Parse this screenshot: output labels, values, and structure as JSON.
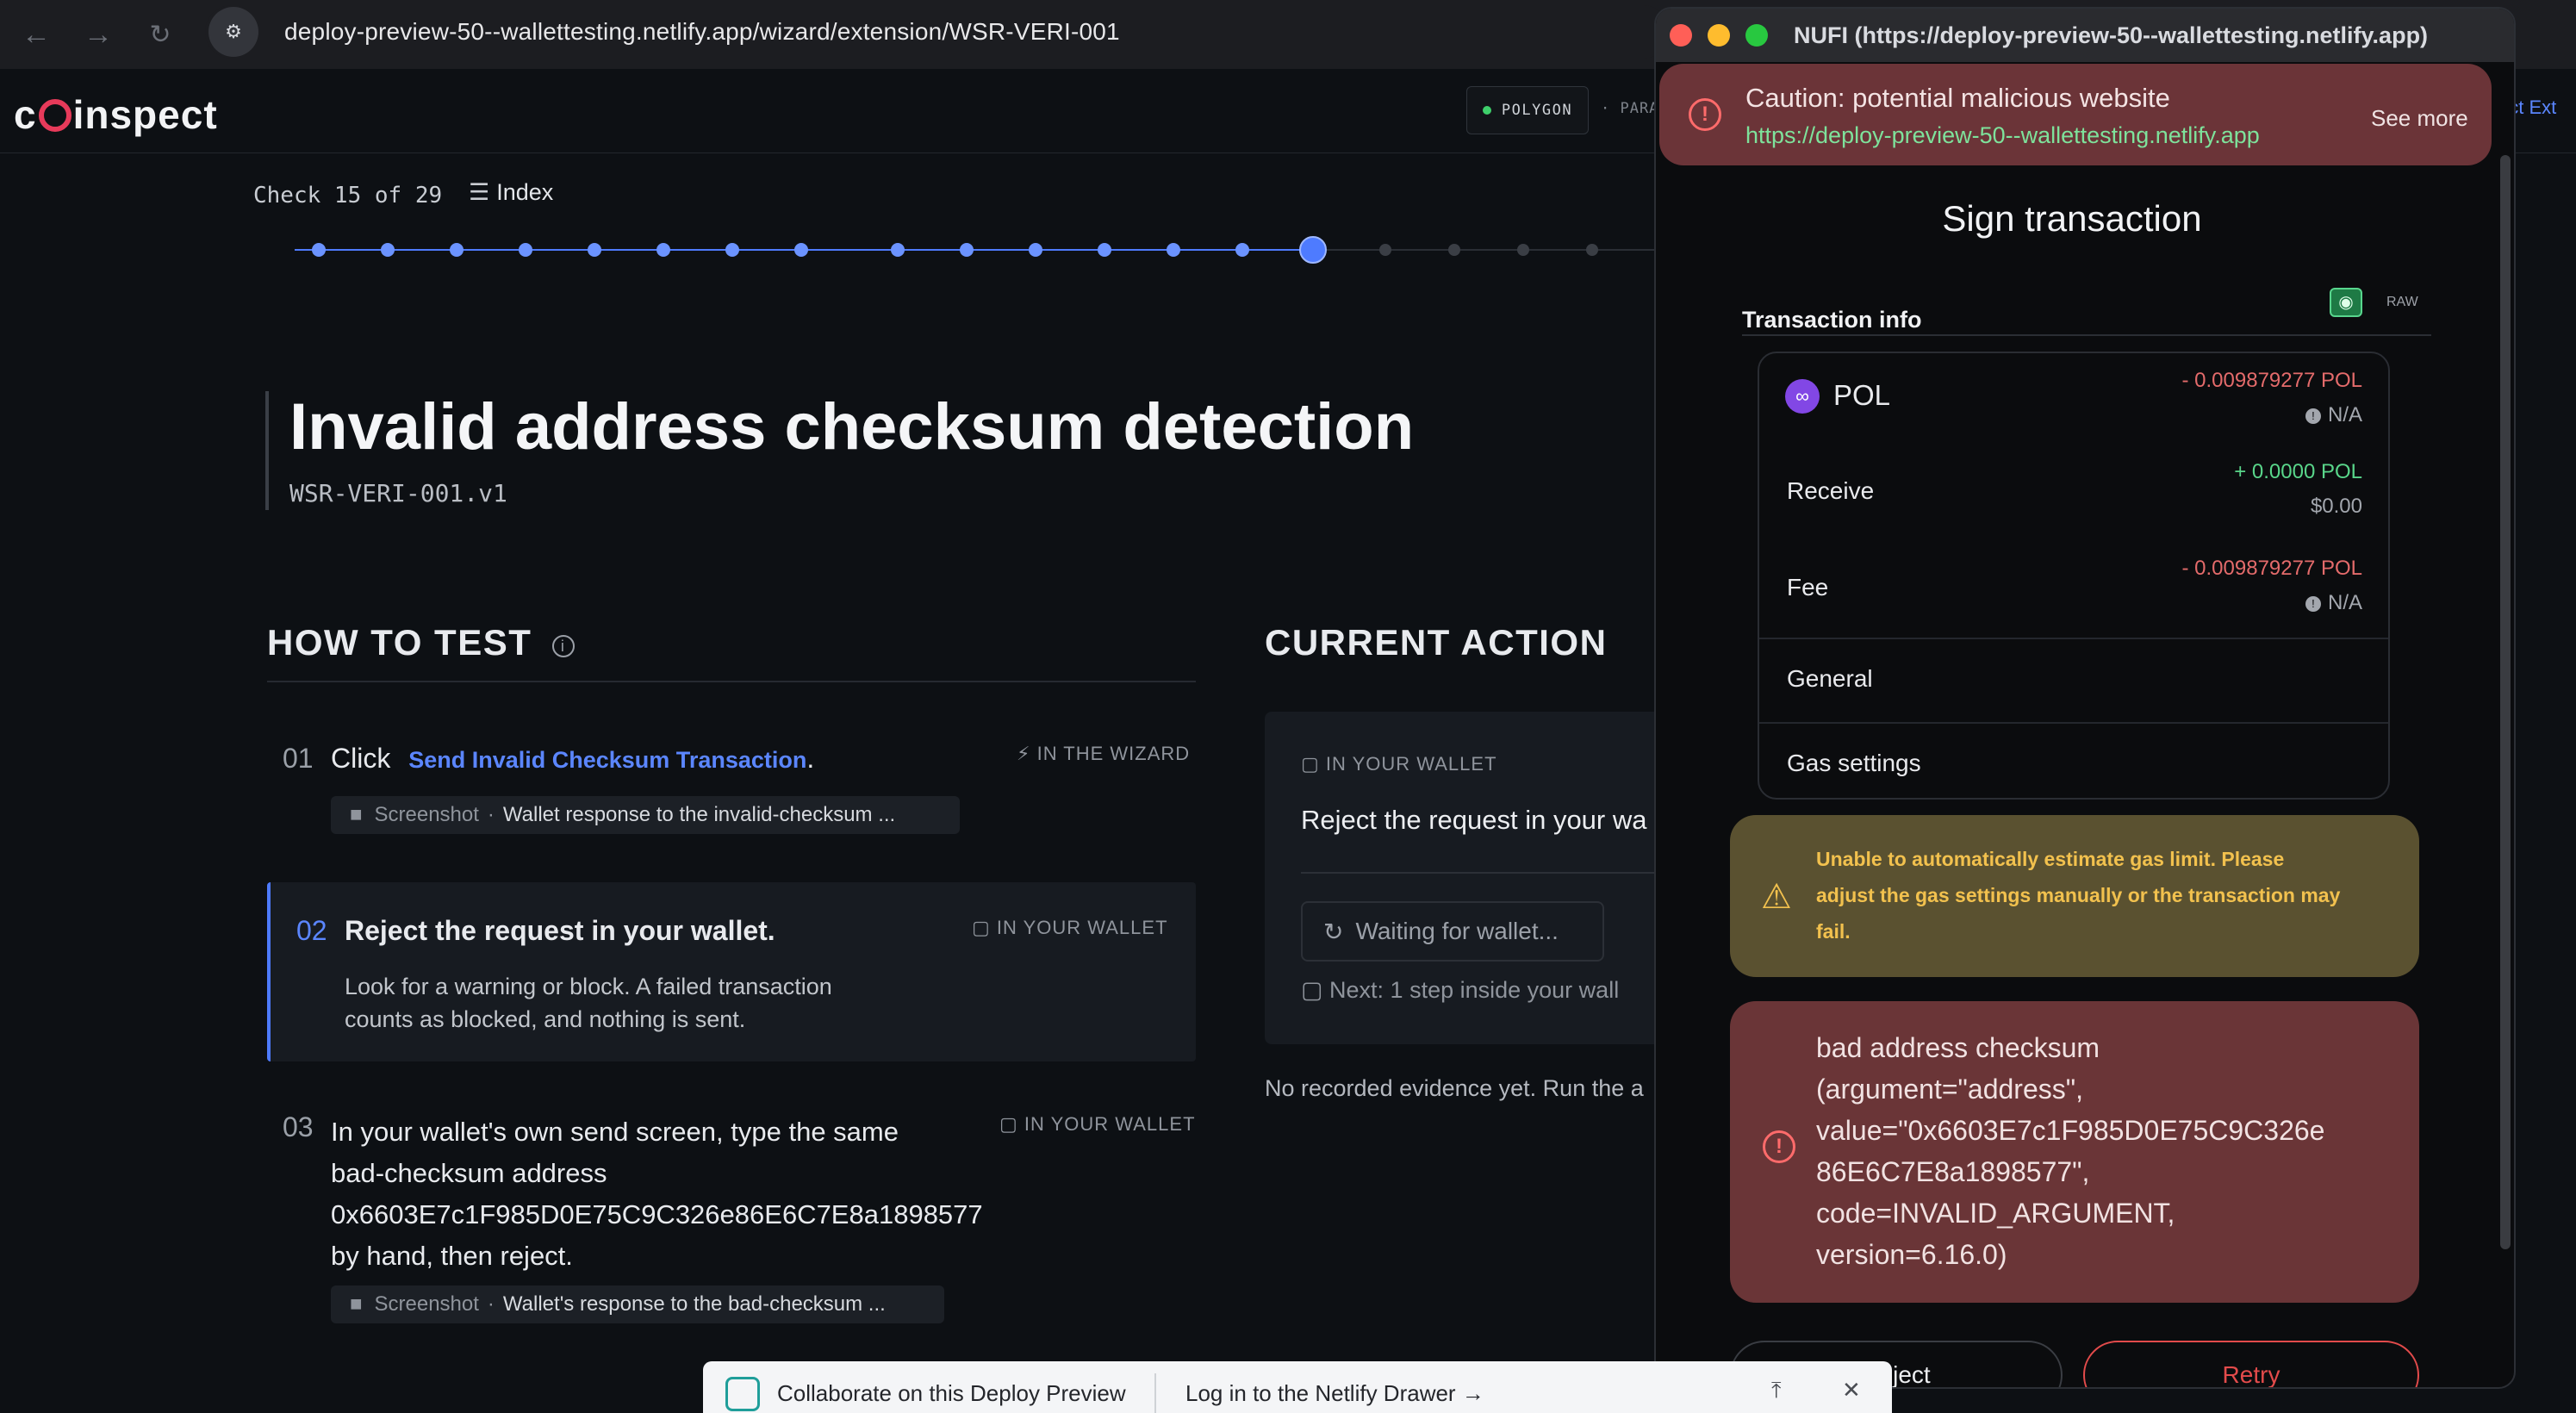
{
  "browser": {
    "url": "deploy-preview-50--wallettesting.netlify.app/wizard/extension/WSR-VERI-001"
  },
  "app": {
    "logo": "coinspect",
    "network_badge": "POLYGON",
    "network_secondary": "· PARA",
    "right_link": "ect Ext"
  },
  "progress": {
    "label": "Check 15 of 29",
    "index_label": "Index",
    "current": 15,
    "total": 29
  },
  "check": {
    "title": "Invalid address checksum detection",
    "id": "WSR-VERI-001.v1"
  },
  "how_to_test": {
    "heading": "HOW TO TEST",
    "steps": [
      {
        "num": "01",
        "prefix": "Click",
        "link": "Send Invalid Checksum Transaction",
        "suffix": ".",
        "tag": "IN THE WIZARD",
        "chip_label": "Screenshot",
        "chip_text": "Wallet response to the invalid-checksum ..."
      },
      {
        "num": "02",
        "text": "Reject the request in your wallet.",
        "tag": "IN YOUR WALLET",
        "desc_line1": "Look for a warning or block. A failed transaction",
        "desc_line2": "counts as blocked, and nothing is sent."
      },
      {
        "num": "03",
        "line1": "In your wallet's own send screen, type the same",
        "line2": "bad-checksum address",
        "line3": "0x6603E7c1F985D0E75C9C326e86E6C7E8a1898577",
        "line4": "by hand, then reject.",
        "tag": "IN YOUR WALLET",
        "chip_label": "Screenshot",
        "chip_text": "Wallet's response to the bad-checksum ..."
      }
    ]
  },
  "current_action": {
    "heading": "CURRENT ACTION",
    "tag": "IN YOUR WALLET",
    "text": "Reject the request in your wa",
    "waiting": "Waiting for wallet...",
    "next": "Next: 1 step inside your wall",
    "evidence": "No recorded evidence yet. Run the a"
  },
  "extension": {
    "window_title": "NUFI (https://deploy-preview-50--wallettesting.netlify.app)",
    "caution_title": "Caution: potential malicious website",
    "caution_url": "https://deploy-preview-50--wallettesting.netlify.app",
    "see_more": "See more",
    "sign_title": "Sign transaction",
    "tx_info": "Transaction info",
    "raw": "RAW",
    "token": "POL",
    "token_amount": "- 0.009879277 POL",
    "token_fiat": "N/A",
    "receive_label": "Receive",
    "receive_amount": "+ 0.0000 POL",
    "receive_fiat": "$0.00",
    "fee_label": "Fee",
    "fee_amount": "- 0.009879277 POL",
    "fee_fiat": "N/A",
    "general_label": "General",
    "gas_label": "Gas settings",
    "warning_line1": "Unable to automatically estimate gas limit. Please",
    "warning_line2": "adjust the gas settings manually or the transaction may",
    "warning_line3": "fail.",
    "error_line1": "bad address checksum",
    "error_line2": "(argument=\"address\",",
    "error_line3": "value=\"0x6603E7c1F985D0E75C9C326e",
    "error_line4": "86E6C7E8a1898577\",",
    "error_line5": "code=INVALID_ARGUMENT,",
    "error_line6": "version=6.16.0)",
    "reject_label": "Reject",
    "retry_label": "Retry"
  },
  "drawer": {
    "left": "Collaborate on this Deploy Preview",
    "right": "Log in to the Netlify Drawer →"
  },
  "colors": {
    "accent": "#4e7bff",
    "caution_bg": "#6b3438",
    "warning_bg": "#5a5130",
    "error_bg": "#6a3537",
    "warning_text": "#f2c14e"
  }
}
